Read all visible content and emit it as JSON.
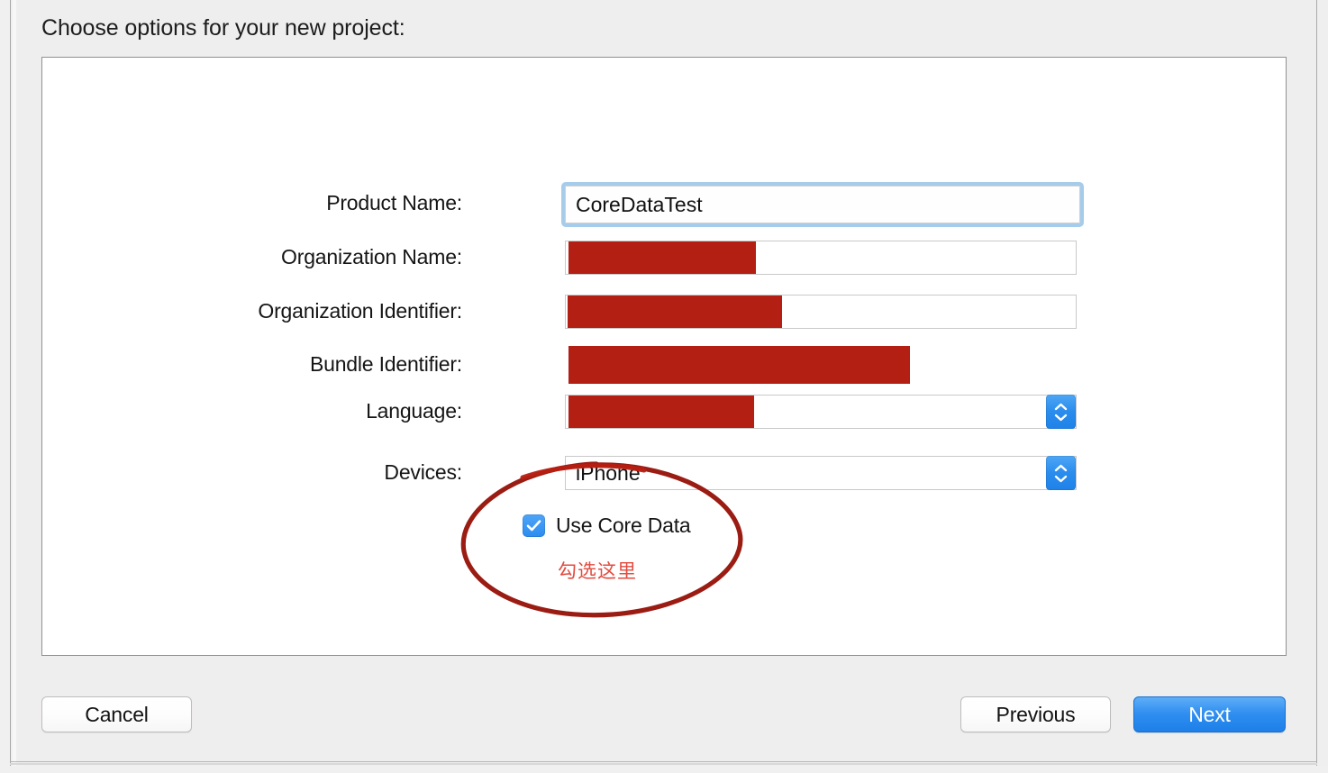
{
  "dialog": {
    "title": "Choose options for your new project:"
  },
  "form": {
    "rows": [
      {
        "label": "Product Name:",
        "value": "CoreDataTest",
        "redacted": false,
        "focused": true,
        "stepper": false
      },
      {
        "label": "Organization Name:",
        "value": "",
        "redacted": true,
        "focused": false,
        "stepper": false
      },
      {
        "label": "Organization Identifier:",
        "value": "",
        "redacted": true,
        "focused": false,
        "stepper": false
      },
      {
        "label": "Bundle Identifier:",
        "value": "",
        "redacted": true,
        "focused": false,
        "stepper": false
      },
      {
        "label": "Language:",
        "value": "",
        "redacted": true,
        "focused": false,
        "stepper": true
      },
      {
        "label": "Devices:",
        "value": "iPhone",
        "redacted": false,
        "focused": false,
        "stepper": true
      }
    ],
    "checkbox": {
      "label": "Use Core Data",
      "checked": true
    }
  },
  "annotation": {
    "text": "勾选这里",
    "color": "#e24b3f",
    "ellipse_color": "#9b1c13"
  },
  "footer": {
    "cancel_label": "Cancel",
    "previous_label": "Previous",
    "next_label": "Next"
  },
  "colors": {
    "redaction": "#b41f13",
    "accent_blue": "#2f8ef0",
    "focus_ring": "#a6ccec",
    "panel_bg": "#ffffff",
    "sheet_bg": "#efeeee"
  }
}
